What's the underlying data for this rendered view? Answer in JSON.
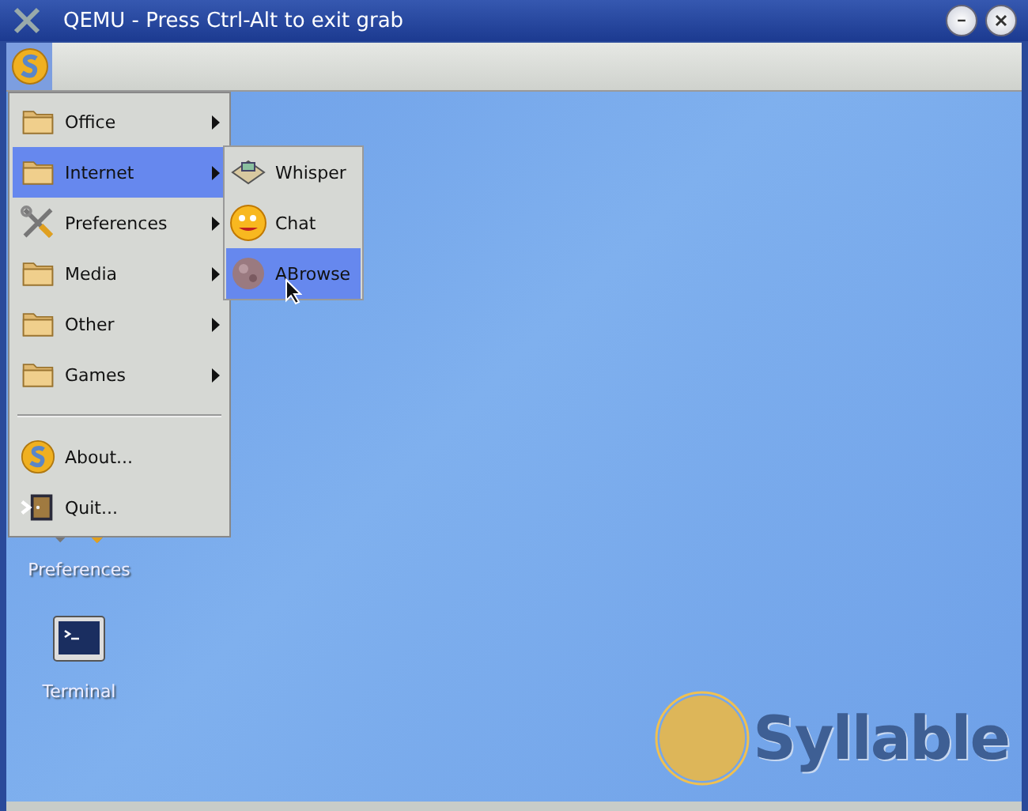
{
  "window": {
    "title": "QEMU - Press Ctrl-Alt to exit grab"
  },
  "taskbar": {
    "start_button": {
      "selected": true
    }
  },
  "menu": {
    "sections": [
      [
        {
          "label": "Office",
          "kind": "folder",
          "has_submenu": true,
          "selected": false
        },
        {
          "label": "Internet",
          "kind": "folder",
          "has_submenu": true,
          "selected": true
        },
        {
          "label": "Preferences",
          "kind": "tools",
          "has_submenu": true,
          "selected": false
        },
        {
          "label": "Media",
          "kind": "folder",
          "has_submenu": true,
          "selected": false
        },
        {
          "label": "Other",
          "kind": "folder",
          "has_submenu": true,
          "selected": false
        },
        {
          "label": "Games",
          "kind": "folder",
          "has_submenu": true,
          "selected": false
        }
      ],
      [
        {
          "label": "About...",
          "kind": "logo",
          "has_submenu": false,
          "selected": false
        },
        {
          "label": "Quit...",
          "kind": "quit",
          "has_submenu": false,
          "selected": false
        }
      ]
    ]
  },
  "submenu": {
    "items": [
      {
        "label": "Whisper",
        "kind": "mail",
        "selected": false
      },
      {
        "label": "Chat",
        "kind": "face",
        "selected": false
      },
      {
        "label": "ABrowse",
        "kind": "globe",
        "selected": true
      }
    ]
  },
  "desktop": {
    "icons": [
      {
        "label": "Preferences",
        "kind": "tools"
      },
      {
        "label": "Terminal",
        "kind": "terminal"
      }
    ]
  },
  "logo": {
    "text": "Syllable"
  }
}
